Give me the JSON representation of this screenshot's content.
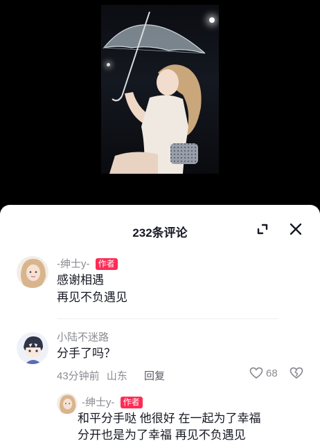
{
  "comments_panel": {
    "title": "232条评论",
    "icons": {
      "expand": "expand-icon",
      "close": "close-icon"
    }
  },
  "comments": [
    {
      "author": "-绅士y-",
      "author_badge": "作者",
      "lines": [
        "感谢相遇",
        "再见不负遇见"
      ]
    },
    {
      "author": "小陆不迷路",
      "lines": [
        "分手了吗？"
      ],
      "time": "43分钟前",
      "location": "山东",
      "reply_label": "回复",
      "like_count": "68"
    }
  ],
  "reply": {
    "author": "-绅士y-",
    "author_badge": "作者",
    "lines": [
      "和平分手哒 他很好 在一起为了幸福",
      "分开也是为了幸福 再见不负遇见"
    ]
  },
  "colors": {
    "accent": "#fe2c55",
    "text": "#161823",
    "muted": "#8a8b91"
  }
}
